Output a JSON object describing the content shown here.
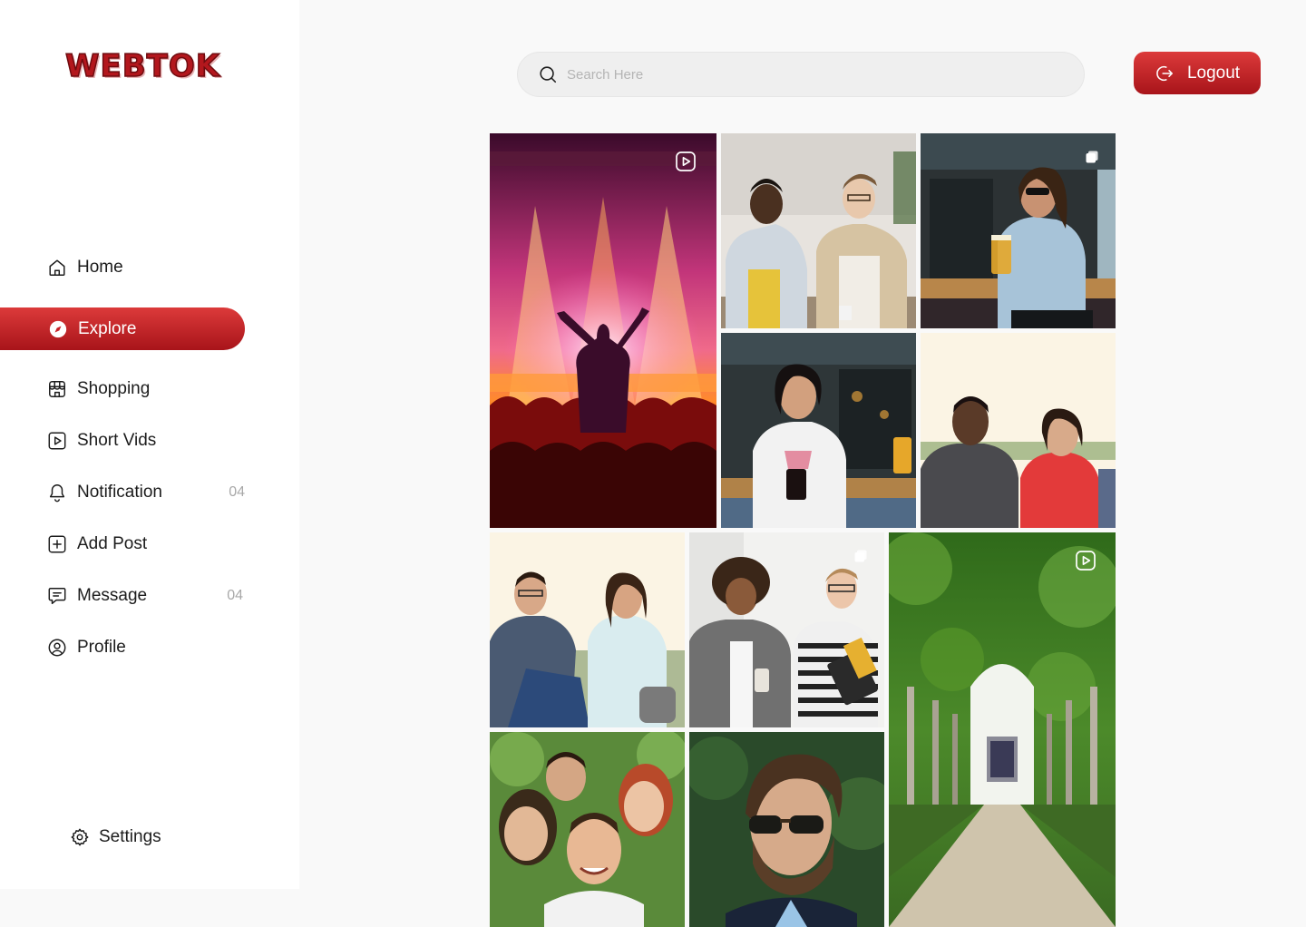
{
  "app": {
    "logo_text": "WEBTOK"
  },
  "sidebar": {
    "items": [
      {
        "label": "Home",
        "icon": "home-icon",
        "count": ""
      },
      {
        "label": "Explore",
        "icon": "compass-icon",
        "count": "",
        "active": true
      },
      {
        "label": "Shopping",
        "icon": "store-icon",
        "count": ""
      },
      {
        "label": "Short Vids",
        "icon": "play-icon",
        "count": ""
      },
      {
        "label": "Notification",
        "icon": "bell-icon",
        "count": "04"
      },
      {
        "label": "Add Post",
        "icon": "plus-square-icon",
        "count": ""
      },
      {
        "label": "Message",
        "icon": "message-icon",
        "count": "04"
      },
      {
        "label": "Profile",
        "icon": "user-circle-icon",
        "count": ""
      }
    ],
    "settings_label": "Settings"
  },
  "header": {
    "search_placeholder": "Search Here",
    "logout_label": "Logout"
  },
  "colors": {
    "accent": "#c62027",
    "accent_dark": "#a8141a",
    "muted_text": "#a8a8a8"
  },
  "grid": {
    "posts": [
      {
        "subject": "concert crowd with stage lights",
        "badge": "video"
      },
      {
        "subject": "two young men sitting together",
        "badge": ""
      },
      {
        "subject": "woman with sunglasses holding beer",
        "badge": "carousel"
      },
      {
        "subject": "smiling woman with beer at bar",
        "badge": ""
      },
      {
        "subject": "man and woman laughing",
        "badge": ""
      },
      {
        "subject": "couple sitting on grass",
        "badge": ""
      },
      {
        "subject": "two women with coffee and notebook",
        "badge": "carousel"
      },
      {
        "subject": "tree-lined garden path",
        "badge": "video"
      },
      {
        "subject": "group selfie of four friends",
        "badge": ""
      },
      {
        "subject": "man wearing sunglasses",
        "badge": ""
      }
    ]
  }
}
